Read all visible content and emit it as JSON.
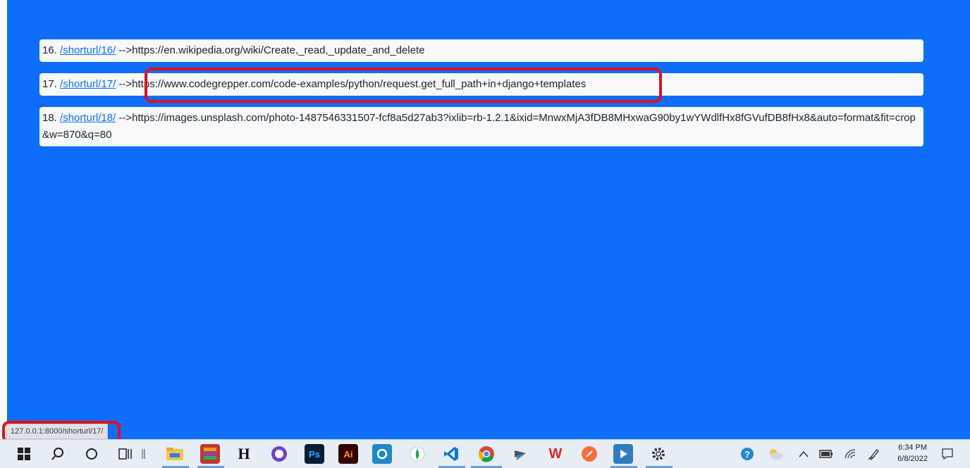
{
  "rows": [
    {
      "num": "16.",
      "link": "/shorturl/16/",
      "arrow": " -->",
      "url": "https://en.wikipedia.org/wiki/Create,_read,_update_and_delete"
    },
    {
      "num": "17.",
      "link": "/shorturl/17/",
      "arrow": " -->",
      "url": "https://www.codegrepper.com/code-examples/python/request.get_full_path+in+django+templates"
    },
    {
      "num": "18.",
      "link": "/shorturl/18/",
      "arrow": " -->",
      "url": "https://images.unsplash.com/photo-1487546331507-fcf8a5d27ab3?ixlib=rb-1.2.1&ixid=MnwxMjA3fDB8MHxwaG90by1wYWdlfHx8fGVufDB8fHx8&auto=format&fit=crop&w=870&q=80"
    }
  ],
  "status_bar": "127.0.0.1:8000/shorturl/17/",
  "clock": {
    "time": "6:34 PM",
    "date": "6/8/2022"
  },
  "colors": {
    "page_bg": "#0d6efd",
    "row_bg": "#f8f9fa",
    "annotation": "#e0101a"
  }
}
